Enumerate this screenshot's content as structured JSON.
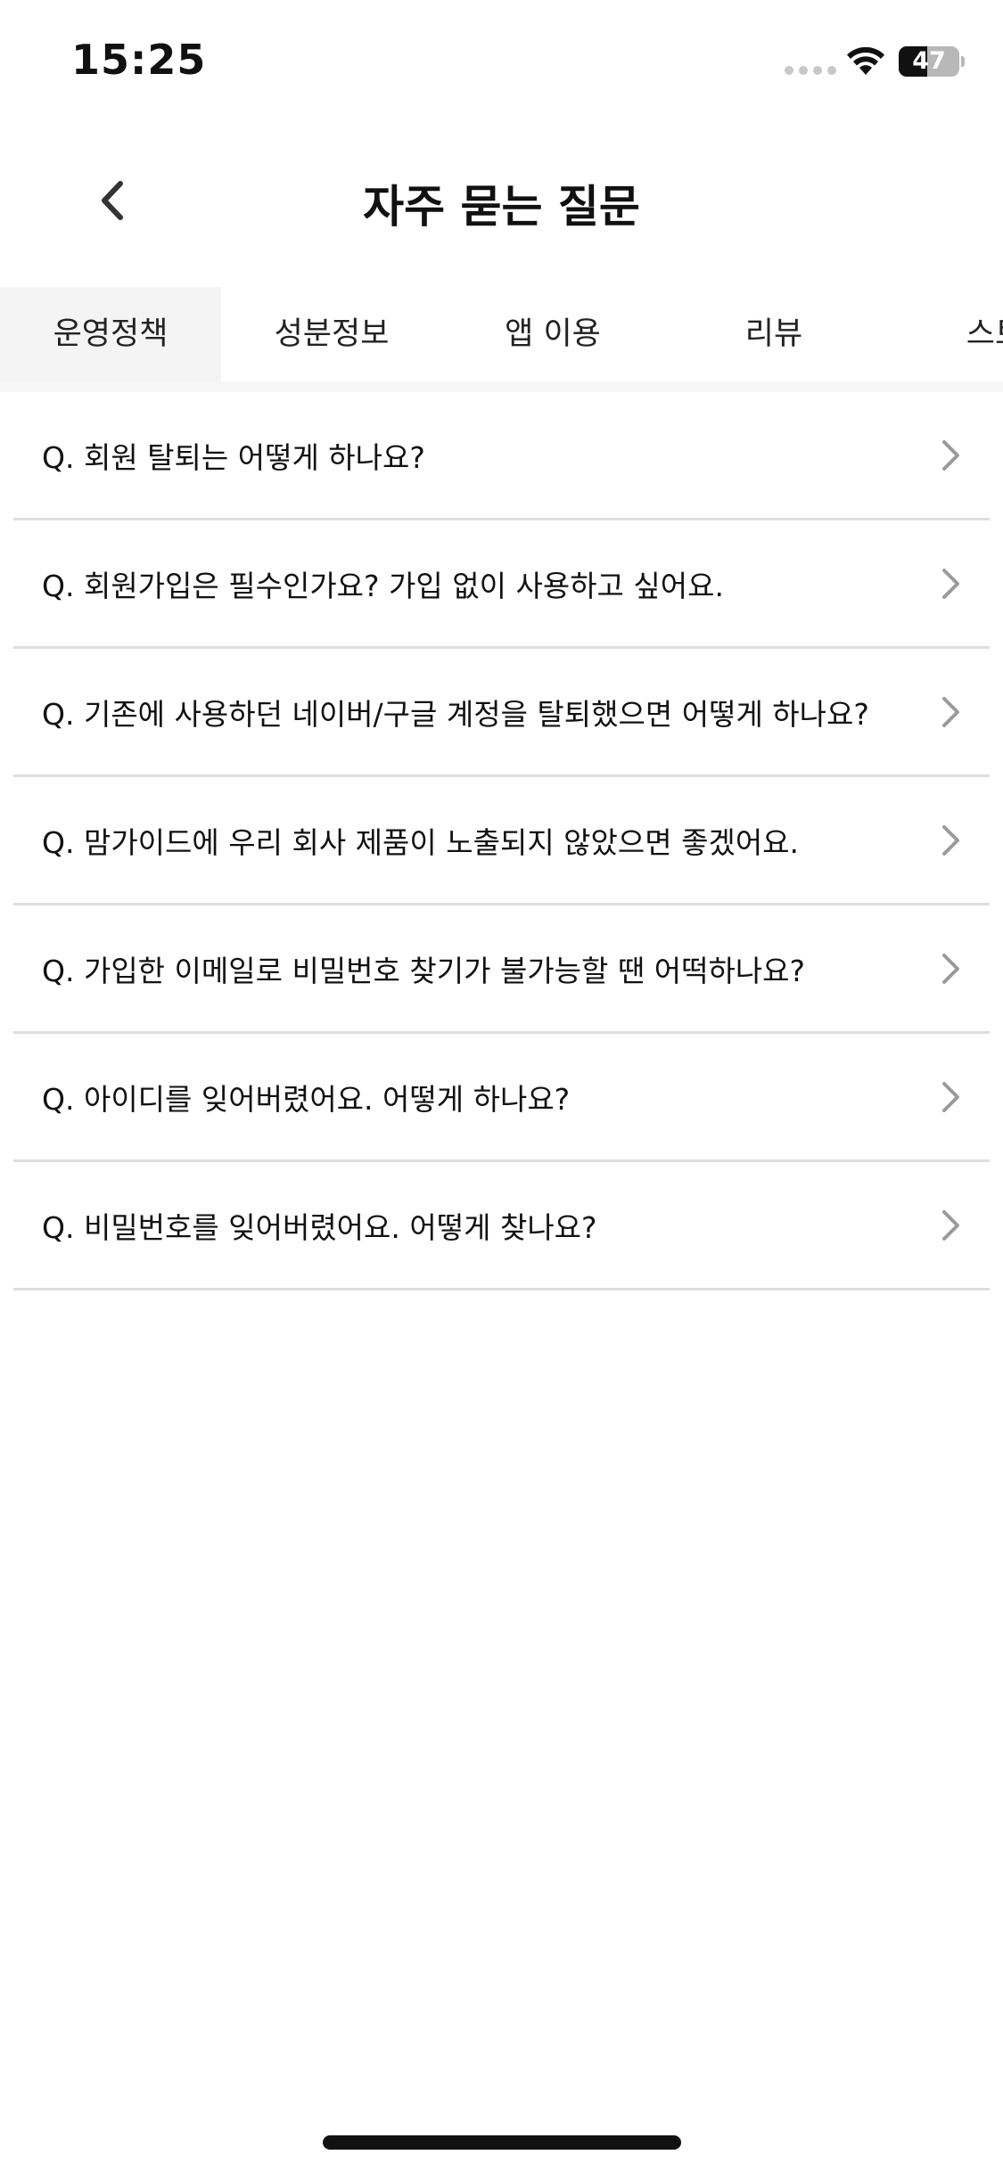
{
  "status_bar": {
    "time": "15:25",
    "battery_level": "47",
    "battery_fraction": 0.47
  },
  "header": {
    "title": "자주 묻는 질문",
    "back_icon": "chevron-left-icon"
  },
  "tabs": [
    {
      "label": "운영정책",
      "active": true
    },
    {
      "label": "성분정보",
      "active": false
    },
    {
      "label": "앱 이용",
      "active": false
    },
    {
      "label": "리뷰",
      "active": false
    },
    {
      "label": "스토",
      "active": false
    }
  ],
  "faq": {
    "items": [
      {
        "question": "Q. 회원 탈퇴는 어떻게 하나요?"
      },
      {
        "question": "Q. 회원가입은 필수인가요? 가입 없이 사용하고 싶어요."
      },
      {
        "question": "Q. 기존에 사용하던 네이버/구글 계정을 탈퇴했으면 어떻게 하나요?"
      },
      {
        "question": "Q. 맘가이드에 우리 회사 제품이 노출되지 않았으면 좋겠어요."
      },
      {
        "question": "Q. 가입한 이메일로 비밀번호 찾기가 불가능할 땐 어떡하나요?"
      },
      {
        "question": "Q. 아이디를 잊어버렸어요. 어떻게 하나요?"
      },
      {
        "question": "Q. 비밀번호를 잊어버렸어요. 어떻게 찾나요?"
      }
    ],
    "item_icon": "chevron-right-icon"
  },
  "colors": {
    "active_tab_bg": "#f4f4f4",
    "divider": "#dedede",
    "chevron": "#9a9a9a",
    "text": "#111111"
  }
}
